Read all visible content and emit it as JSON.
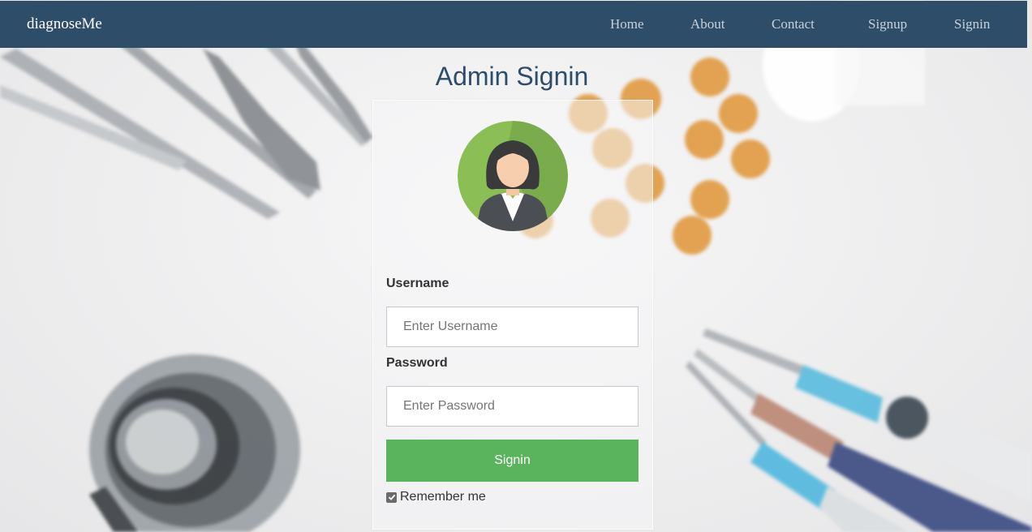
{
  "navbar": {
    "brand": "diagnoseMe",
    "links": [
      "Home",
      "About",
      "Contact",
      "Signup",
      "Signin"
    ],
    "background_color": "#2d4d69"
  },
  "page": {
    "title": "Admin Signin"
  },
  "form": {
    "avatar_icon": "female-user-avatar-icon",
    "username_label": "Username",
    "username_placeholder": "Enter Username",
    "password_label": "Password",
    "password_placeholder": "Enter Password",
    "submit_label": "Signin",
    "submit_color": "#5ab35d",
    "remember_label": "Remember me",
    "remember_checked": true
  }
}
